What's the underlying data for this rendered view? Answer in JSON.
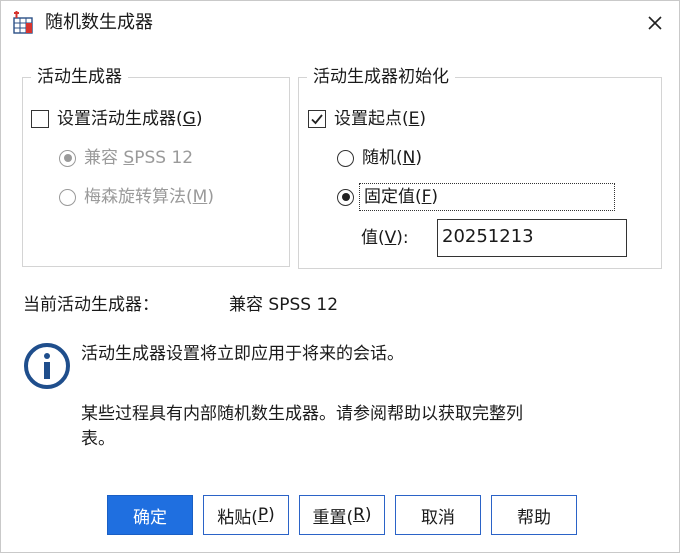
{
  "window": {
    "title": "随机数生成器",
    "app_icon": "spss-table-icon",
    "close_icon": "close-icon"
  },
  "active_generator_group": {
    "legend": "活动生成器",
    "set_active": {
      "label_prefix": "设置活动生成器(",
      "mnemonic": "G",
      "label_suffix": ")",
      "checked": false
    },
    "options": [
      {
        "label_prefix": "兼容 ",
        "mnemonic": "S",
        "label_suffix": "PSS 12",
        "selected": true,
        "disabled": true
      },
      {
        "label_prefix": "梅森旋转算法(",
        "mnemonic": "M",
        "label_suffix": ")",
        "selected": false,
        "disabled": true
      }
    ]
  },
  "initialization_group": {
    "legend": "活动生成器初始化",
    "set_start": {
      "label_prefix": "设置起点(",
      "mnemonic": "E",
      "label_suffix": ")",
      "checked": true
    },
    "random": {
      "label_prefix": "随机(",
      "mnemonic": "N",
      "label_suffix": ")",
      "selected": false
    },
    "fixed": {
      "label_prefix": "固定值(",
      "mnemonic": "F",
      "label_suffix": ")",
      "selected": true
    },
    "value": {
      "label_prefix": "值(",
      "mnemonic": "V",
      "label_suffix": "):",
      "input_value": "20251213"
    }
  },
  "status": {
    "label": "当前活动生成器：",
    "value": "兼容 SPSS 12"
  },
  "info": {
    "icon": "info-icon",
    "line1": "活动生成器设置将立即应用于将来的会话。",
    "line2": "某些过程具有内部随机数生成器。请参阅帮助以获取完整列",
    "line3": "表。"
  },
  "buttons": {
    "ok": "确定",
    "paste": {
      "prefix": "粘贴(",
      "mnemonic": "P",
      "suffix": ")"
    },
    "reset": {
      "prefix": "重置(",
      "mnemonic": "R",
      "suffix": ")"
    },
    "cancel": "取消",
    "help": "帮助"
  },
  "colors": {
    "primary_button": "#1f6fe0",
    "button_border": "#2b63c7",
    "info_icon": "#1f4e8c",
    "disabled_text": "#9a9a9a"
  }
}
